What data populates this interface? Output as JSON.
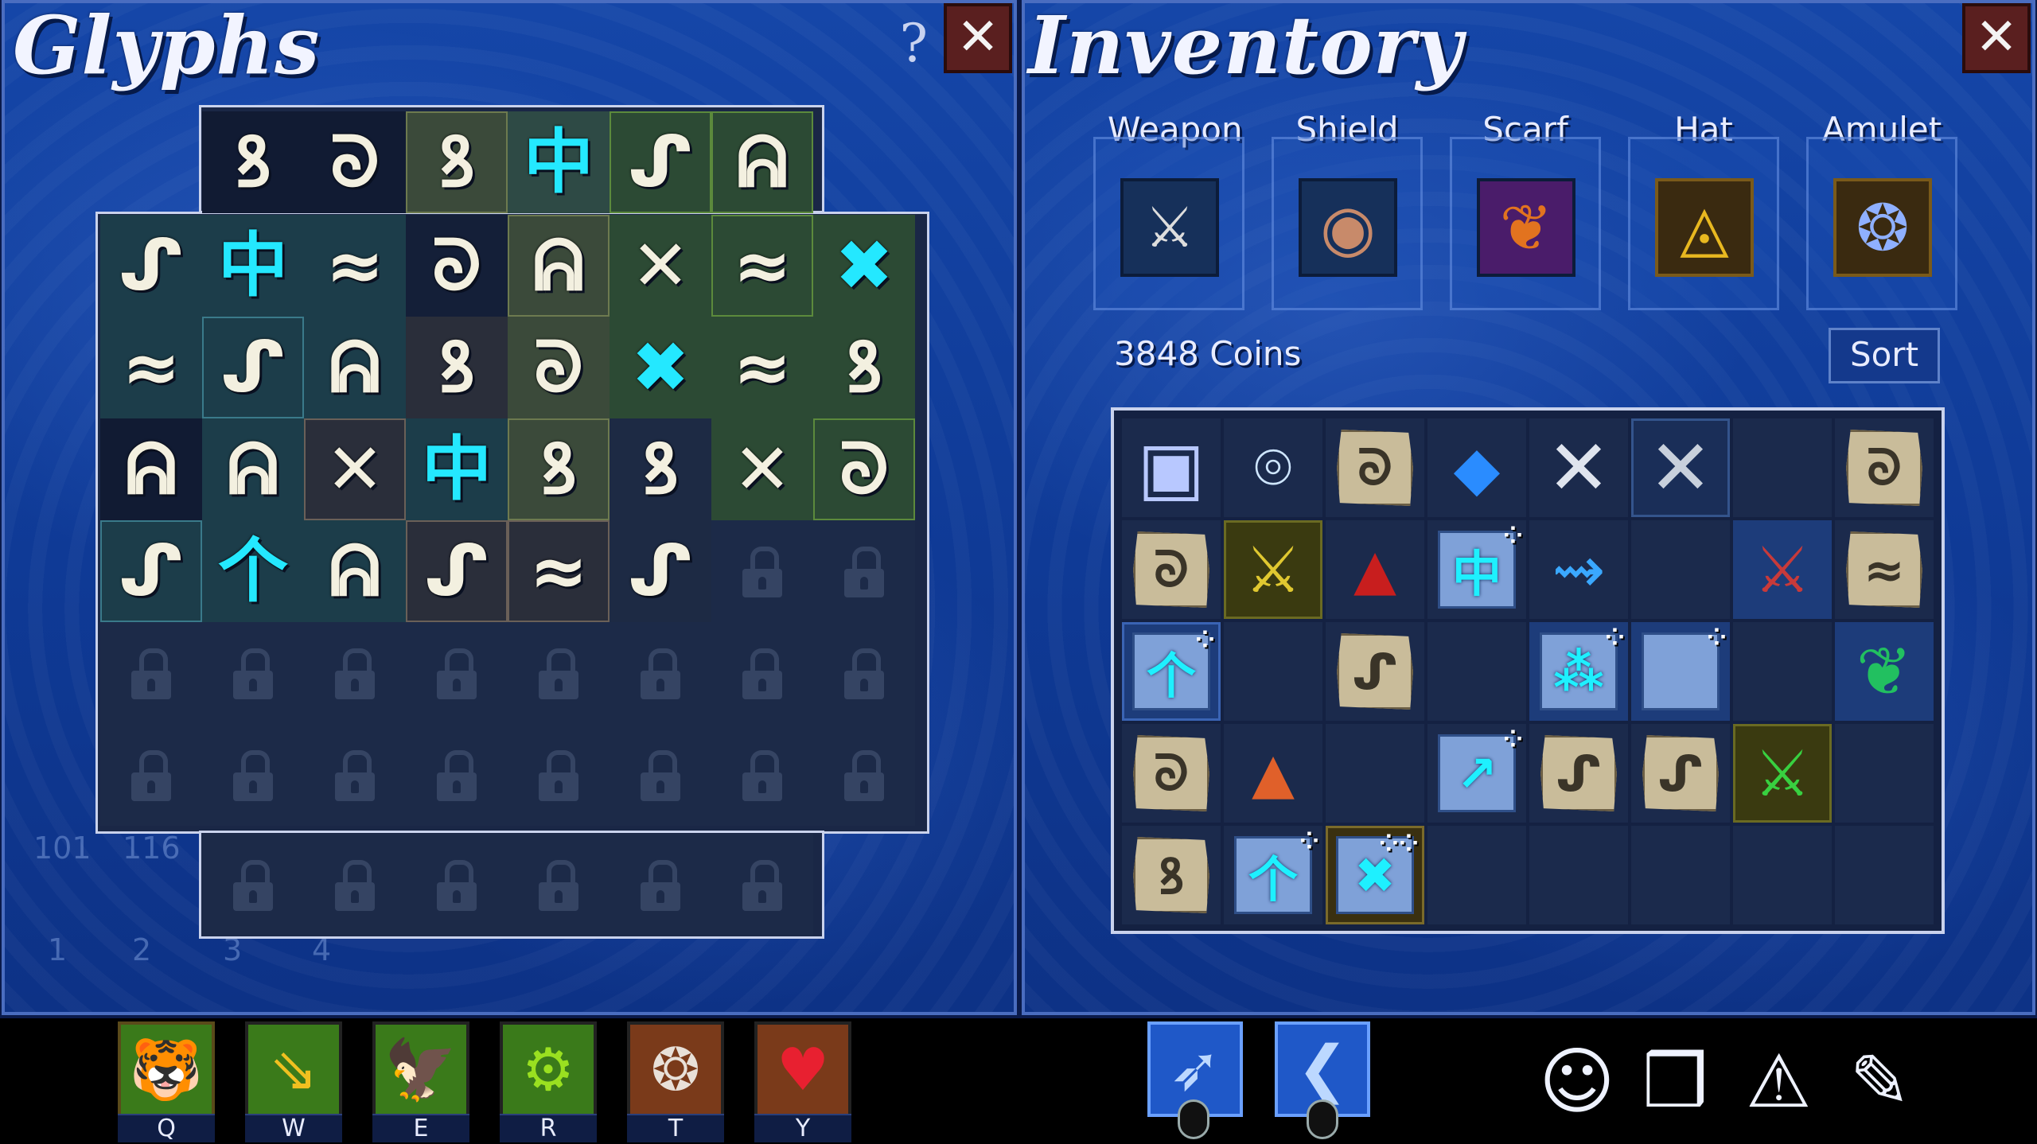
{
  "glyphs_panel": {
    "title": "Glyphs",
    "help": "?",
    "close": "✕",
    "rows": [
      [
        "",
        "",
        "ꝸ",
        "ᘐ",
        "ꝸ",
        "中",
        "ᔑ",
        "ᕱ",
        "",
        ""
      ],
      [
        "ᔑ",
        "中",
        "≈",
        "ᘐ",
        "ᕱ",
        "✕",
        "≈",
        "✖"
      ],
      [
        "≈",
        "ᔑ",
        "ᕱ",
        "ꝸ",
        "ᘐ",
        "✖",
        "≈",
        "ꝸ"
      ],
      [
        "ᕱ",
        "ᕱ",
        "✕",
        "中",
        "ꝸ",
        "ꝸ",
        "✕",
        "ᘐ"
      ],
      [
        "ᔑ",
        "个",
        "ᕱ",
        "ᔑ",
        "≈",
        "ᔑ",
        "🔒",
        "🔒"
      ]
    ],
    "faded_numbers": [
      "101",
      "116",
      "1",
      "2",
      "3",
      "4"
    ]
  },
  "inventory_panel": {
    "title": "Inventory",
    "close": "✕",
    "equipment": [
      {
        "label": "Weapon",
        "icon": "⚔"
      },
      {
        "label": "Shield",
        "icon": "◉"
      },
      {
        "label": "Scarf",
        "icon": "❦"
      },
      {
        "label": "Hat",
        "icon": "◬"
      },
      {
        "label": "Amulet",
        "icon": "❂"
      }
    ],
    "coins": "3848 Coins",
    "sort": "Sort",
    "items": {
      "r0": [
        "▣",
        "⌾",
        "ᘐ",
        "◆",
        "✕",
        "✕",
        "",
        "ᘐ"
      ],
      "r1": [
        "ᘐ",
        "⚔",
        "▲",
        "中",
        "⇝",
        "",
        "⚔",
        "≈"
      ],
      "r2": [
        "个",
        "",
        "ᔑ",
        "⁂",
        "⁂",
        "",
        "",
        "❦"
      ],
      "r3": [
        "ᘐ",
        "▲",
        "",
        "↗",
        "ᔑ",
        "ᔑ",
        "⚔",
        ""
      ],
      "r4": [
        "ꝸ",
        "个",
        "✖",
        "",
        "",
        "",
        "",
        ""
      ]
    }
  },
  "hotbar": {
    "skills": [
      {
        "key": "Q",
        "icon": "tiger-icon",
        "glyph": "🐯",
        "color": "#3a7a1a"
      },
      {
        "key": "W",
        "icon": "arrows-icon",
        "glyph": "⇘",
        "color": "#3a7a1a"
      },
      {
        "key": "E",
        "icon": "eagle-icon",
        "glyph": "🦅",
        "color": "#3a7a1a"
      },
      {
        "key": "R",
        "icon": "gear-icon",
        "glyph": "⚙",
        "color": "#3a7a1a"
      },
      {
        "key": "T",
        "icon": "fang-icon",
        "glyph": "❂",
        "color": "#7a3a1a"
      },
      {
        "key": "Y",
        "icon": "heart-icon",
        "glyph": "♥",
        "color": "#7a3a1a"
      }
    ],
    "weapons": [
      {
        "icon": "bow-icon",
        "glyph": "➶"
      },
      {
        "icon": "shield-arc-icon",
        "glyph": "❮"
      }
    ],
    "menu": [
      {
        "icon": "head-icon",
        "glyph": "☺"
      },
      {
        "icon": "backpack-icon",
        "glyph": "❒"
      },
      {
        "icon": "triangle-icon",
        "glyph": "⚠"
      },
      {
        "icon": "book-icon",
        "glyph": "✎"
      }
    ]
  }
}
